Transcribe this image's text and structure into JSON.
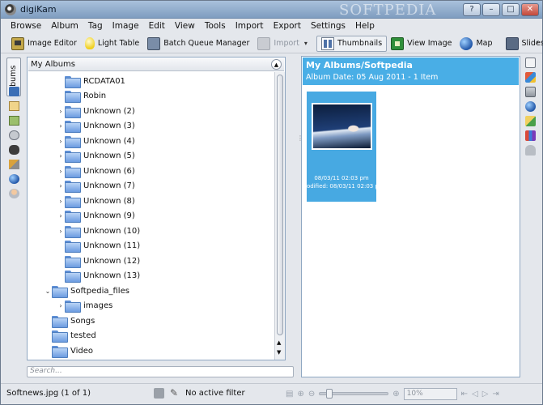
{
  "window": {
    "title": "digiKam",
    "watermark": "SOFTPEDIA",
    "buttons": {
      "help": "?",
      "minimize": "–",
      "maximize": "□",
      "close": "✕"
    }
  },
  "menu": [
    "Browse",
    "Album",
    "Tag",
    "Image",
    "Edit",
    "View",
    "Tools",
    "Import",
    "Export",
    "Settings",
    "Help"
  ],
  "toolbar": {
    "image_editor": "Image Editor",
    "light_table": "Light Table",
    "batch_queue_manager": "Batch Queue Manager",
    "import": "Import",
    "thumbnails": "Thumbnails",
    "view_image": "View Image",
    "map": "Map",
    "slideshow": "Slideshow",
    "more": "›"
  },
  "left_tab": {
    "label": "Albums"
  },
  "albums_panel": {
    "header": "My Albums",
    "tree": [
      {
        "label": "RCDATA01",
        "expandable": false,
        "level": 3
      },
      {
        "label": "Robin",
        "expandable": false,
        "level": 3
      },
      {
        "label": "Unknown (2)",
        "expandable": true,
        "level": 3
      },
      {
        "label": "Unknown (3)",
        "expandable": true,
        "level": 3
      },
      {
        "label": "Unknown (4)",
        "expandable": true,
        "level": 3
      },
      {
        "label": "Unknown (5)",
        "expandable": true,
        "level": 3
      },
      {
        "label": "Unknown (6)",
        "expandable": true,
        "level": 3
      },
      {
        "label": "Unknown (7)",
        "expandable": true,
        "level": 3
      },
      {
        "label": "Unknown (8)",
        "expandable": true,
        "level": 3
      },
      {
        "label": "Unknown (9)",
        "expandable": true,
        "level": 3
      },
      {
        "label": "Unknown (10)",
        "expandable": true,
        "level": 3
      },
      {
        "label": "Unknown (11)",
        "expandable": false,
        "level": 3
      },
      {
        "label": "Unknown (12)",
        "expandable": false,
        "level": 3
      },
      {
        "label": "Unknown (13)",
        "expandable": false,
        "level": 3
      },
      {
        "label": "Softpedia_files",
        "expandable": true,
        "expanded": true,
        "level": 2
      },
      {
        "label": "images",
        "expandable": true,
        "level": 3
      },
      {
        "label": "Songs",
        "expandable": false,
        "level": 2
      },
      {
        "label": "tested",
        "expandable": false,
        "level": 2
      },
      {
        "label": "Video",
        "expandable": false,
        "level": 2
      }
    ]
  },
  "search": {
    "placeholder": "Search..."
  },
  "icon_view": {
    "title": "My Albums/Softpedia",
    "subtitle": "Album Date: 05 Aug 2011 - 1 Item",
    "items": [
      {
        "line1": "08/03/11 02:03 pm",
        "line2": "odified: 08/03/11 02:03 p"
      }
    ]
  },
  "status": {
    "file": "Softnews.jpg (1 of 1)",
    "filter": "No active filter",
    "zoom": "10%"
  }
}
